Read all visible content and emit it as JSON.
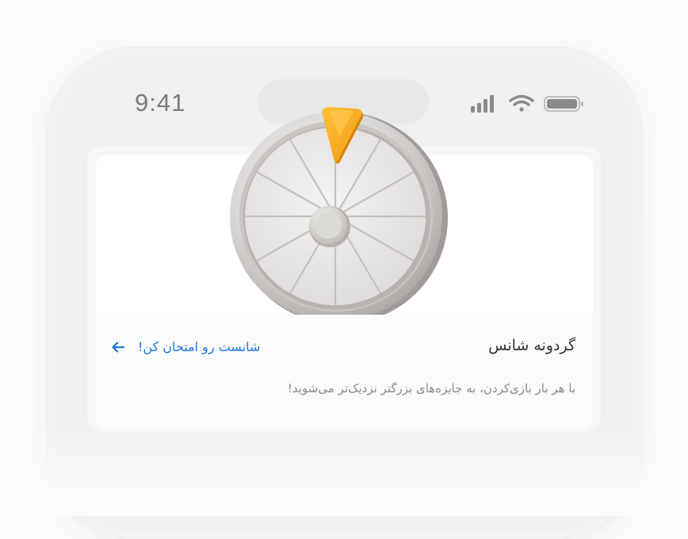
{
  "status_bar": {
    "time": "9:41",
    "icons": [
      "signal-icon",
      "wifi-icon",
      "battery-icon"
    ]
  },
  "card": {
    "image": "wheel-of-fortune",
    "title": "گردونه شانس",
    "cta_label": "شانست رو امتحان کن!",
    "cta_icon": "arrow-left-icon",
    "subtitle": "با هر بار بازی‌کردن، به جایزه‌های بزرگتر نزدیک‌تر می‌شوید!"
  },
  "colors": {
    "accent": "#1a78e2",
    "pointer": "#f5a623",
    "title_text": "#333333",
    "subtitle_text": "#8a8a8a"
  }
}
